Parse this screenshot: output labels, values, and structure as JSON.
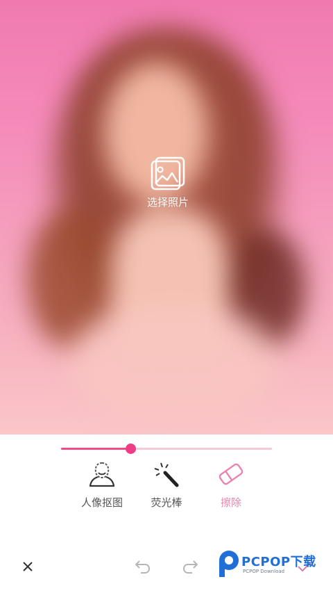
{
  "canvas": {
    "select_photo_label": "选择照片",
    "icon": "photo-gallery-icon"
  },
  "slider": {
    "value_fraction": 0.33,
    "track_color": "#f6c7d9",
    "fill_color": "#ee4b8b"
  },
  "tools": [
    {
      "id": "portrait-cutout",
      "label": "人像抠图",
      "icon": "person-outline-icon",
      "active": false
    },
    {
      "id": "magic-wand",
      "label": "荧光棒",
      "icon": "magic-wand-icon",
      "active": false
    },
    {
      "id": "eraser",
      "label": "擦除",
      "icon": "eraser-icon",
      "active": true
    }
  ],
  "bottom_bar": {
    "close_icon": "close-icon",
    "undo_icon": "undo-icon",
    "redo_icon": "redo-icon",
    "confirm_icon": "checkmark-icon"
  },
  "watermark": {
    "text": "PCPOP下载",
    "subtext": "PCPOP Download"
  },
  "colors": {
    "accent": "#ee3d84",
    "active_label": "#e884b1"
  }
}
